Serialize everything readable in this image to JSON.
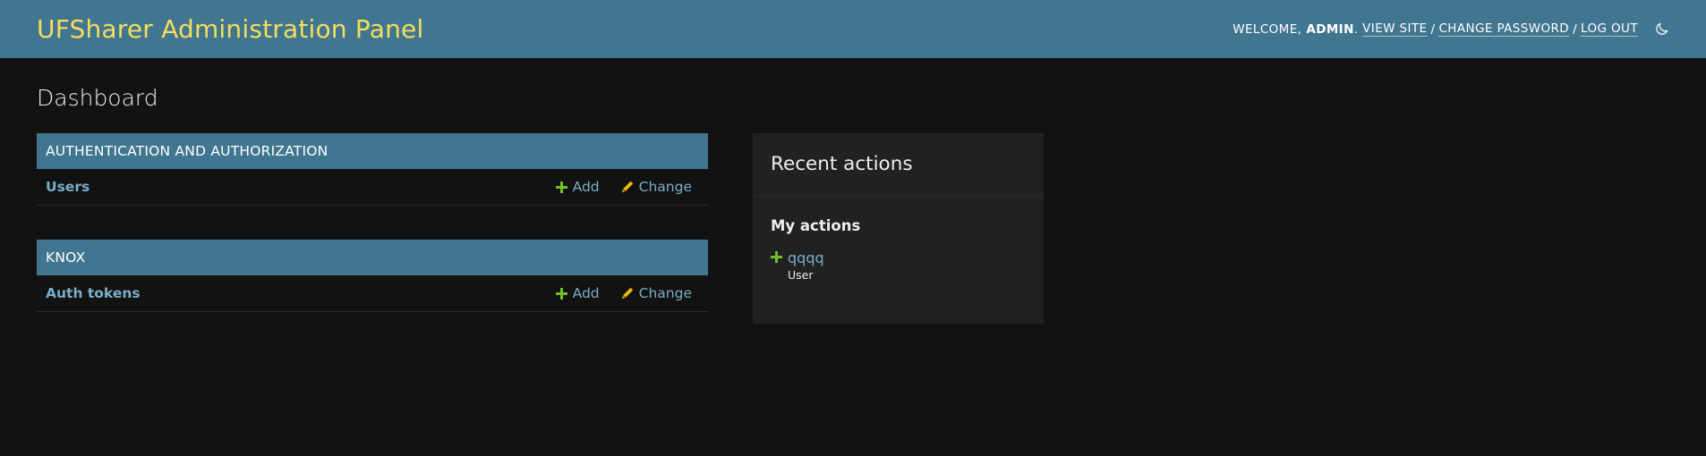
{
  "header": {
    "branding": "UFSharer Administration Panel",
    "welcome": "Welcome,",
    "username": "admin",
    "view_site": "View site",
    "change_password": "Change password",
    "log_out": "Log out",
    "separator": "/",
    "theme_icon": "moon-icon"
  },
  "page": {
    "title": "Dashboard"
  },
  "modules": [
    {
      "caption": "Authentication and Authorization",
      "rows": [
        {
          "name": "Users",
          "add_label": "Add",
          "change_label": "Change"
        }
      ]
    },
    {
      "caption": "Knox",
      "rows": [
        {
          "name": "Auth tokens",
          "add_label": "Add",
          "change_label": "Change"
        }
      ]
    }
  ],
  "recent_actions": {
    "title": "Recent actions",
    "subtitle": "My actions",
    "items": [
      {
        "name": "qqqq",
        "type": "User",
        "icon": "add-icon"
      }
    ]
  },
  "colors": {
    "header_bg": "#417690",
    "branding": "#f5dd5d",
    "link": "#79aec8",
    "add_icon": "#70bf2b",
    "change_icon": "#efb80b",
    "page_bg": "#121212",
    "panel_bg": "#212121"
  }
}
